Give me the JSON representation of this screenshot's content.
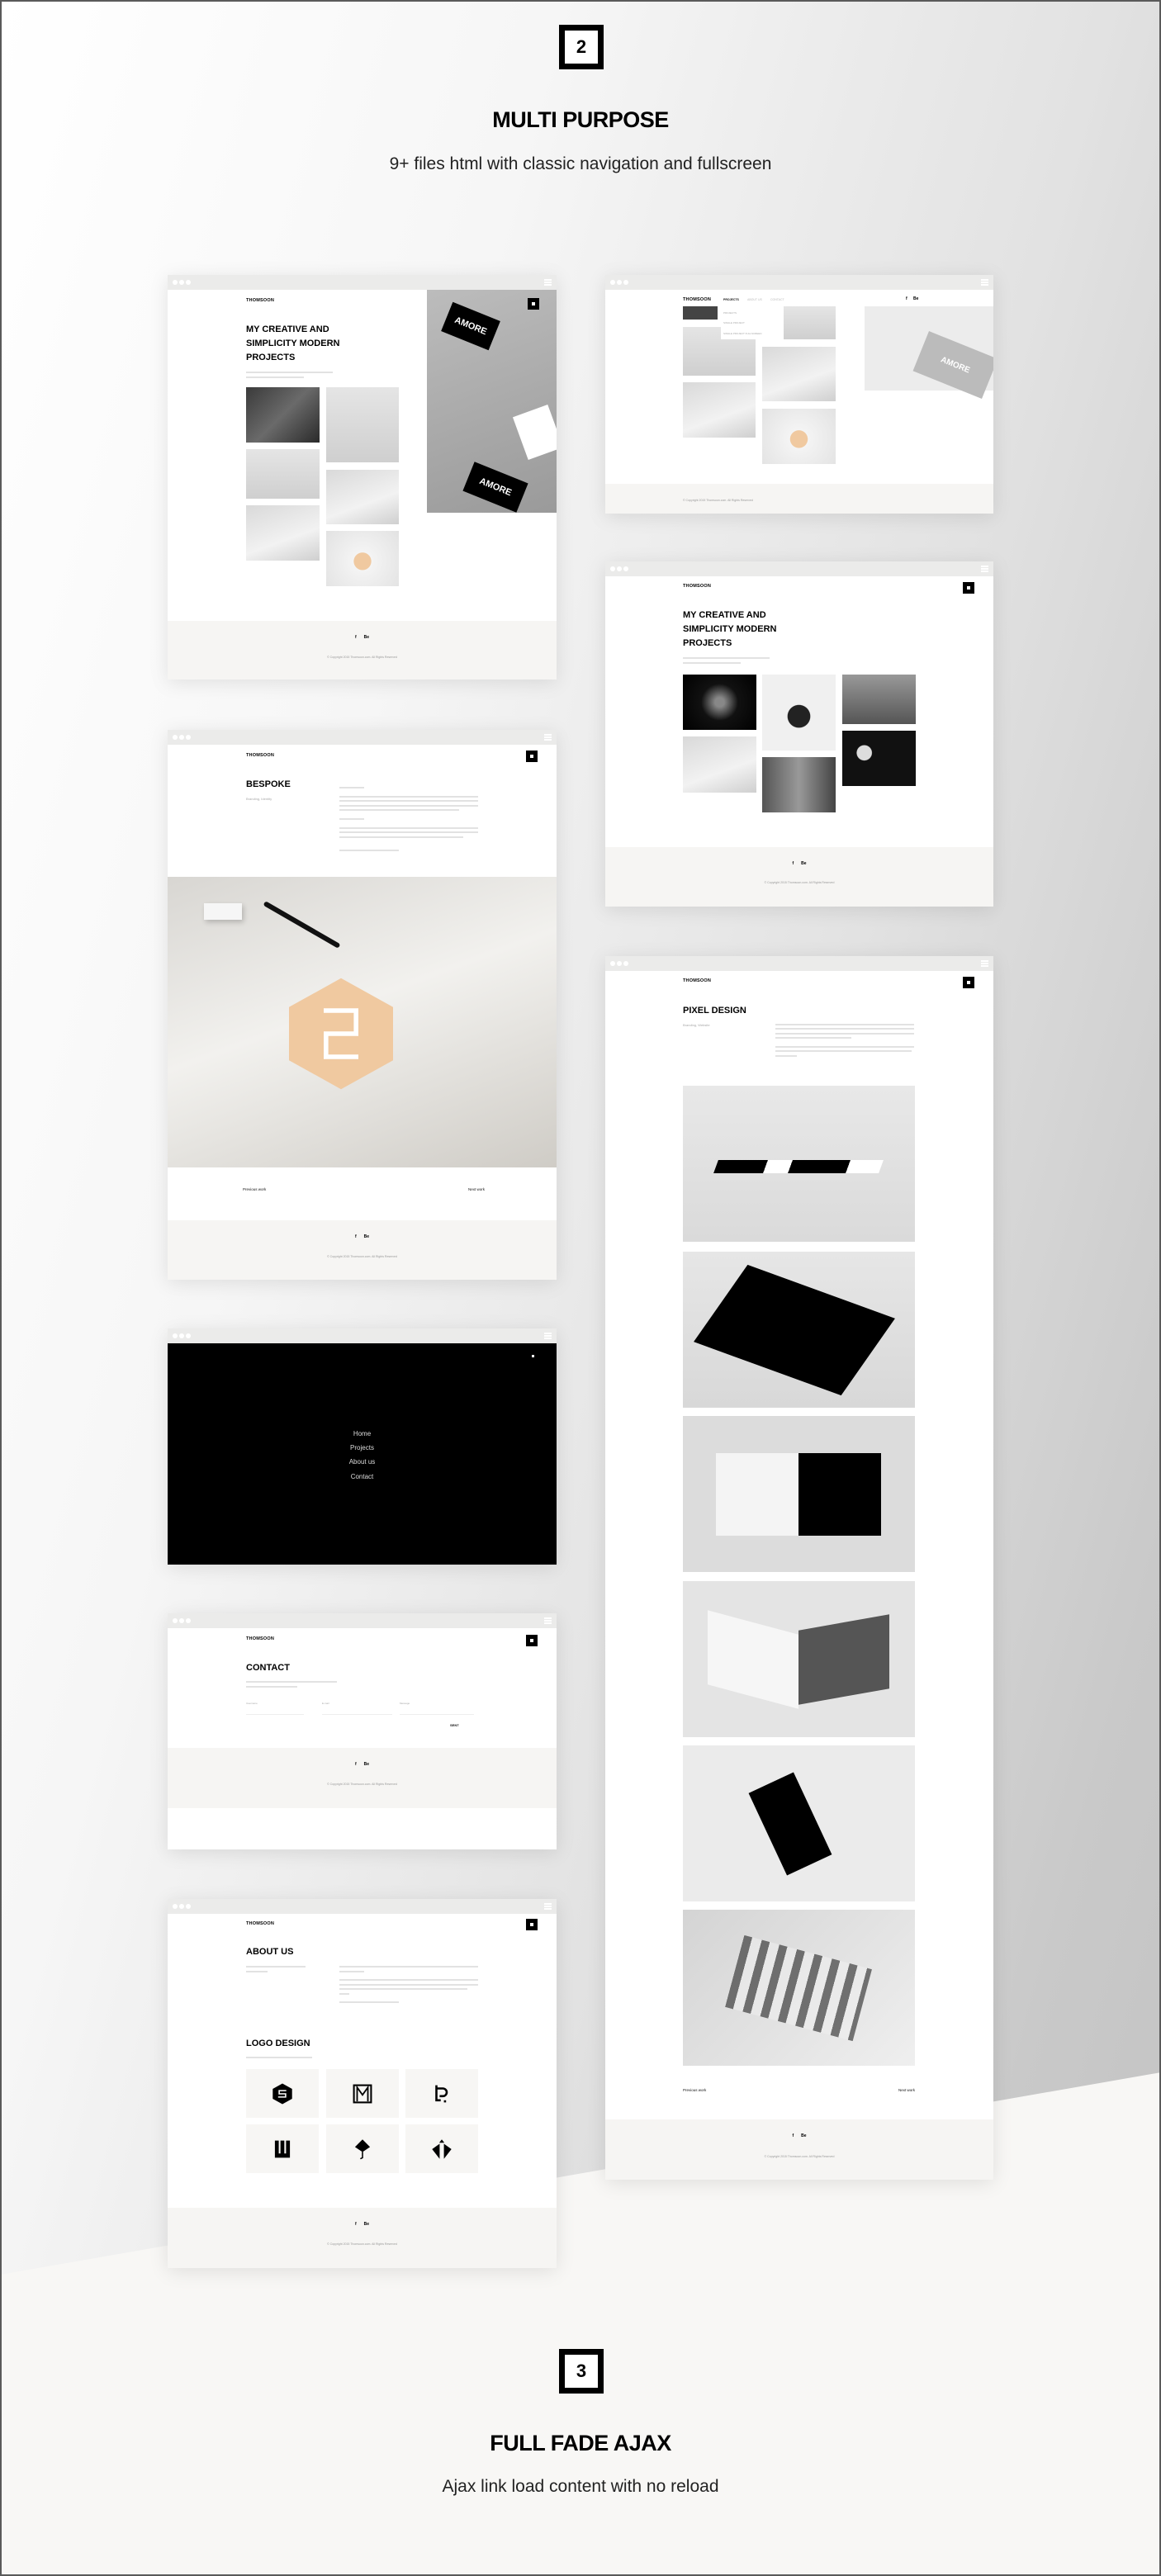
{
  "section2": {
    "number": "2",
    "title": "MULTI PURPOSE",
    "subtitle": "9+ files html with classic navigation and fullscreen"
  },
  "section3": {
    "number": "3",
    "title": "FULL FADE AJAX",
    "subtitle": "Ajax link load content with no reload"
  },
  "site": {
    "logo": "THOMSOON",
    "social": [
      "f",
      "Be"
    ],
    "copyright": "© Copyright 2015 Thomsoon.com. All Rights Reserved",
    "prev": "Previous work",
    "next": "Next work"
  },
  "home": {
    "heading": [
      "MY CREATIVE AND",
      "SIMPLICITY MODERN",
      "PROJECTS"
    ],
    "card_text": "AMORE"
  },
  "dropdown": {
    "nav": [
      "PROJECTS",
      "ABOUT US",
      "CONTACT"
    ],
    "submenu": [
      "PROJECTS",
      "SINGLE PROJECT",
      "SINGLE PROJECT FULLSCREEN"
    ],
    "card_text": "AMORE"
  },
  "bespoke": {
    "title": "BESPOKE",
    "category": "Branding, Identity"
  },
  "menu": {
    "items": [
      "Home",
      "Projects",
      "About us",
      "Contact"
    ]
  },
  "contact": {
    "title": "CONTACT",
    "fields": [
      "Username",
      "E-mail",
      "Message"
    ],
    "submit": "SENT"
  },
  "about": {
    "title": "ABOUT US",
    "logo_title": "LOGO DESIGN",
    "logo_icons": [
      "hexagon-s-logo",
      "m-frame-logo",
      "p-logo",
      "w-logo",
      "pen-nib-logo",
      "diamond-t-logo"
    ]
  },
  "pixel": {
    "title": "PIXEL DESIGN",
    "category": "Branding, Website"
  },
  "colors": {
    "footer_bg": "#f6f5f3",
    "browser_bar": "#ebebea",
    "accent": "#000000",
    "logo_peach": "#f0c9a0"
  }
}
